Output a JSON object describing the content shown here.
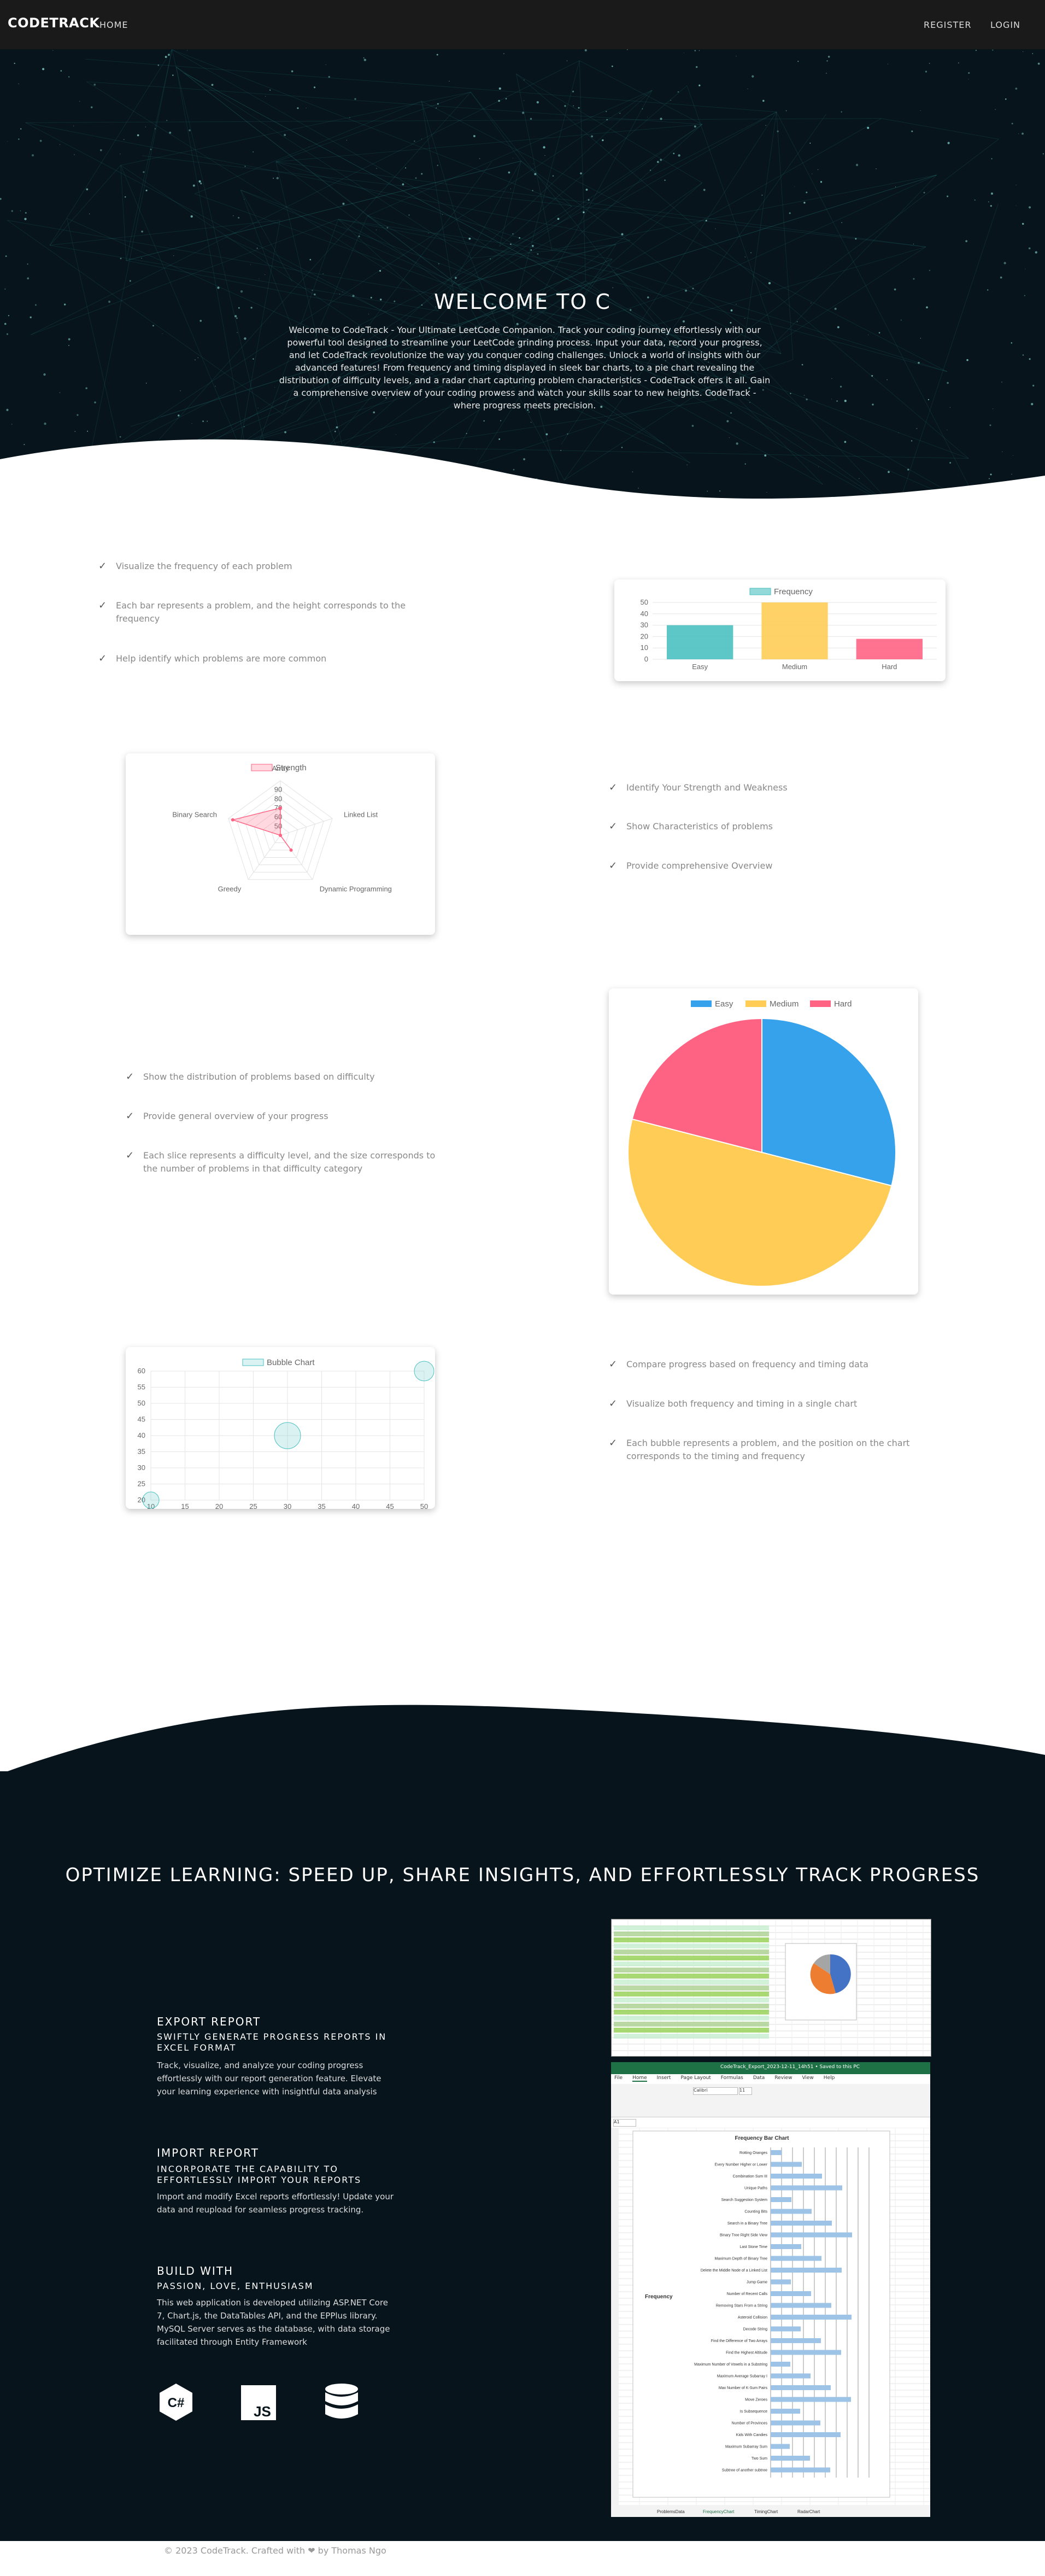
{
  "nav": {
    "brand": "CODETRACK",
    "home": "HOME",
    "register": "REGISTER",
    "login": "LOGIN"
  },
  "hero": {
    "title": "WELCOME TO C",
    "text": "Welcome to CodeTrack - Your Ultimate LeetCode Companion. Track your coding journey effortlessly with our powerful tool designed to streamline your LeetCode grinding process. Input your data, record your progress, and let CodeTrack revolutionize the way you conquer coding challenges. Unlock a world of insights with our advanced features! From frequency and timing displayed in sleek bar charts, to a pie chart revealing the distribution of difficulty levels, and a radar chart capturing problem characteristics - CodeTrack offers it all. Gain a comprehensive overview of your coding prowess and watch your skills soar to new heights. CodeTrack - where progress meets precision."
  },
  "features": {
    "bar": [
      "Visualize the frequency of each problem",
      "Each bar represents a problem, and the height corresponds to the frequency",
      "Help identify which problems are more common"
    ],
    "radar": [
      "Identify Your Strength and Weakness",
      "Show Characteristics of problems",
      "Provide comprehensive Overview"
    ],
    "pie": [
      "Show the distribution of problems based on difficulty",
      "Provide general overview of your progress",
      "Each slice represents a difficulty level, and the size corresponds to the number of problems in that difficulty category"
    ],
    "bubble": [
      "Compare progress based on frequency and timing data",
      "Visualize both frequency and timing in a single chart",
      "Each bubble represents a problem, and the position on the chart corresponds to the timing and frequency"
    ]
  },
  "chart_data": [
    {
      "type": "bar",
      "legend": "Frequency",
      "categories": [
        "Easy",
        "Medium",
        "Hard"
      ],
      "values": [
        30,
        50,
        18
      ],
      "ylim": [
        0,
        50
      ],
      "yticks": [
        0,
        10,
        20,
        30,
        40,
        50
      ],
      "colors": [
        "#4bc0c0",
        "#ffcd56",
        "#ff6384"
      ]
    },
    {
      "type": "radar",
      "legend": "Strength",
      "axes": [
        "Array",
        "Linked List",
        "Dynamic Programming",
        "Greedy",
        "Binary Search"
      ],
      "values": [
        70,
        30,
        60,
        10,
        95
      ],
      "rticks": [
        50,
        60,
        70,
        80,
        90
      ],
      "color": "#ff6384"
    },
    {
      "type": "pie",
      "labels": [
        "Easy",
        "Medium",
        "Hard"
      ],
      "values": [
        29,
        50,
        21
      ],
      "colors": [
        "#36a2eb",
        "#ffcd56",
        "#ff6384"
      ]
    },
    {
      "type": "scatter",
      "legend": "Bubble Chart",
      "points": [
        {
          "x": 10,
          "y": 20,
          "r": 10
        },
        {
          "x": 30,
          "y": 40,
          "r": 16
        },
        {
          "x": 50,
          "y": 60,
          "r": 12
        }
      ],
      "xlim": [
        10,
        50
      ],
      "ylim": [
        20,
        60
      ],
      "xticks": [
        10,
        15,
        20,
        25,
        30,
        35,
        40,
        45,
        50
      ],
      "yticks": [
        20,
        25,
        30,
        35,
        40,
        45,
        50,
        55,
        60
      ]
    }
  ],
  "optimize": {
    "title": "OPTIMIZE LEARNING: SPEED UP, SHARE INSIGHTS, AND EFFORTLESSLY TRACK PROGRESS"
  },
  "export": {
    "heading": "EXPORT REPORT",
    "sub": "SWIFTLY GENERATE PROGRESS REPORTS IN EXCEL FORMAT",
    "text": "Track, visualize, and analyze your coding progress effortlessly with our report generation feature. Elevate your learning experience with insightful data analysis"
  },
  "import": {
    "heading": "IMPORT REPORT",
    "sub": "INCORPORATE THE CAPABILITY TO EFFORTLESSLY IMPORT YOUR REPORTS",
    "text": "Import and modify Excel reports effortlessly! Update your data and reupload for seamless progress tracking."
  },
  "build": {
    "heading": "BUILD WITH",
    "sub": "PASSION, LOVE, ENTHUSIASM",
    "text": "This web application is developed utilizing ASP.NET Core 7, Chart.js, the DataTables API, and the EPPlus library. MySQL Server serves as the database, with data storage facilitated through Entity Framework"
  },
  "tech_icons": {
    "csharp": "C#",
    "js": "JS"
  },
  "excel": {
    "title": "CodeTrack_Export_2023-12-11_14h51 • Saved to this PC",
    "menu": [
      "File",
      "Home",
      "Insert",
      "Page Layout",
      "Formulas",
      "Data",
      "Review",
      "View",
      "Help"
    ],
    "chart_title": "Frequency Bar Chart",
    "axis_label": "Frequency",
    "problems": [
      "Rotting Oranges",
      "Every Number Higher or Lower",
      "Combination Sum III",
      "Unique Paths",
      "Search Suggestion System",
      "Counting Bits",
      "Search in a Binary Tree",
      "Binary Tree Right Side View",
      "Last Stone Time",
      "Maximum Depth of Binary Tree",
      "Delete the Middle Node of a Linked List",
      "Jump Game",
      "Number of Recent Calls",
      "Removing Stars From a String",
      "Asteroid Collision",
      "Decode String",
      "Find the Difference of Two Arrays",
      "Find the Highest Altitude",
      "Maximum Number of Vowels in a Substring",
      "Maximum Average Subarray I",
      "Max Number of K-Sum Pairs",
      "Move Zeroes",
      "Is Subsequence",
      "Number of Provinces",
      "Kids With Candies",
      "Maximum Subarray Sum",
      "Two Sum",
      "Subtree of another subtree"
    ],
    "tabs": [
      "ProblemsData",
      "FrequencyChart",
      "TimingChart",
      "RadarChart"
    ],
    "font": "Calibri",
    "font_size": "11",
    "cell_ref": "A1"
  },
  "footer": {
    "text": "© 2023 CodeTrack. Crafted with ❤ by Thomas Ngo"
  }
}
